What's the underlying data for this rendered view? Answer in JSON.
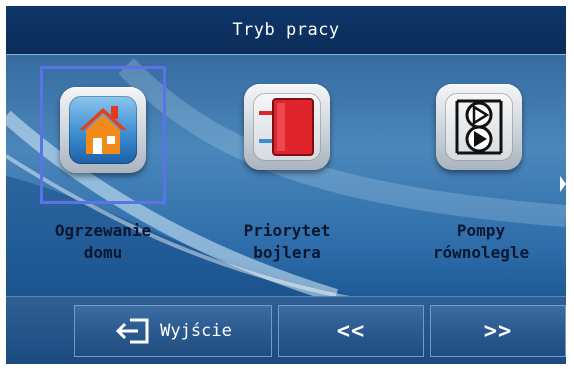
{
  "header": {
    "title": "Tryb pracy"
  },
  "tiles": [
    {
      "label": "Ogrzewanie\ndomu",
      "icon": "house-icon",
      "selected": true
    },
    {
      "label": "Priorytet\nbojlera",
      "icon": "boiler-icon",
      "selected": false
    },
    {
      "label": "Pompy\nrównolegle",
      "icon": "parallel-pumps-icon",
      "selected": false
    }
  ],
  "footer": {
    "exit_label": "Wyjście",
    "prev_label": "<<",
    "next_label": ">>"
  },
  "colors": {
    "selection": "#5b73e6",
    "title_bar": "#0b2c59",
    "accent_red": "#e0242c"
  }
}
